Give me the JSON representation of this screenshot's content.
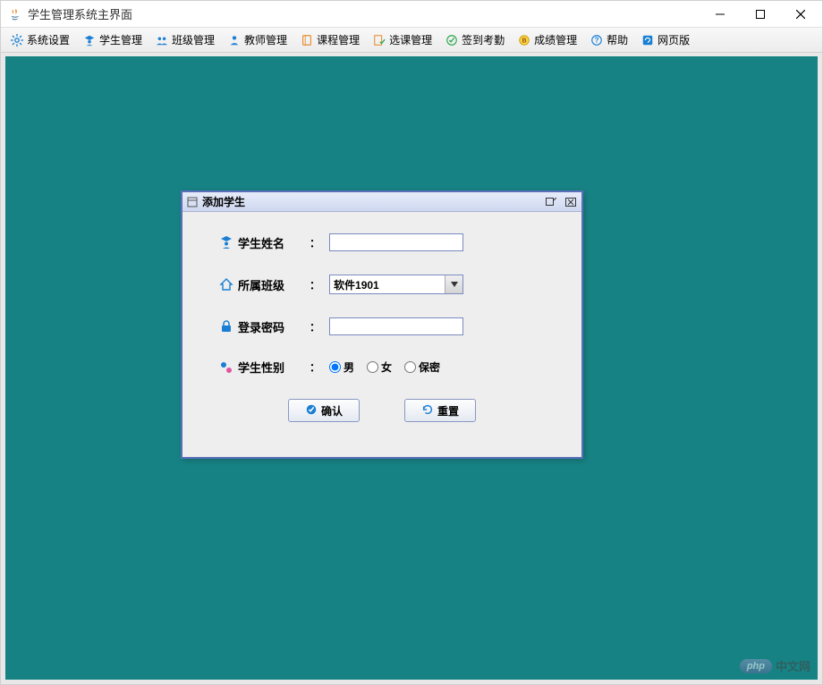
{
  "window": {
    "title": "学生管理系统主界面"
  },
  "toolbar": {
    "items": [
      {
        "label": "系统设置",
        "icon": "gear-icon",
        "color": "#1a7fd4"
      },
      {
        "label": "学生管理",
        "icon": "student-icon",
        "color": "#1a7fd4"
      },
      {
        "label": "班级管理",
        "icon": "group-icon",
        "color": "#1a7fd4"
      },
      {
        "label": "教师管理",
        "icon": "teacher-icon",
        "color": "#1a7fd4"
      },
      {
        "label": "课程管理",
        "icon": "book-icon",
        "color": "#e88b2e"
      },
      {
        "label": "选课管理",
        "icon": "checklist-icon",
        "color": "#e88b2e"
      },
      {
        "label": "签到考勤",
        "icon": "check-circle-icon",
        "color": "#2aa54a"
      },
      {
        "label": "成绩管理",
        "icon": "badge-icon",
        "color": "#d4aa00"
      },
      {
        "label": "帮助",
        "icon": "question-icon",
        "color": "#1a7fd4"
      },
      {
        "label": "网页版",
        "icon": "globe-icon",
        "color": "#1a7fd4"
      }
    ]
  },
  "internalFrame": {
    "title": "添加学生",
    "fields": {
      "name": {
        "label": "学生姓名",
        "value": ""
      },
      "class": {
        "label": "所属班级",
        "value": "软件1901"
      },
      "password": {
        "label": "登录密码",
        "value": ""
      },
      "gender": {
        "label": "学生性别",
        "options": [
          "男",
          "女",
          "保密"
        ],
        "selected": "男"
      }
    },
    "buttons": {
      "confirm": "确认",
      "reset": "重置"
    }
  },
  "watermark": {
    "brand": "php",
    "text": "中文网"
  }
}
